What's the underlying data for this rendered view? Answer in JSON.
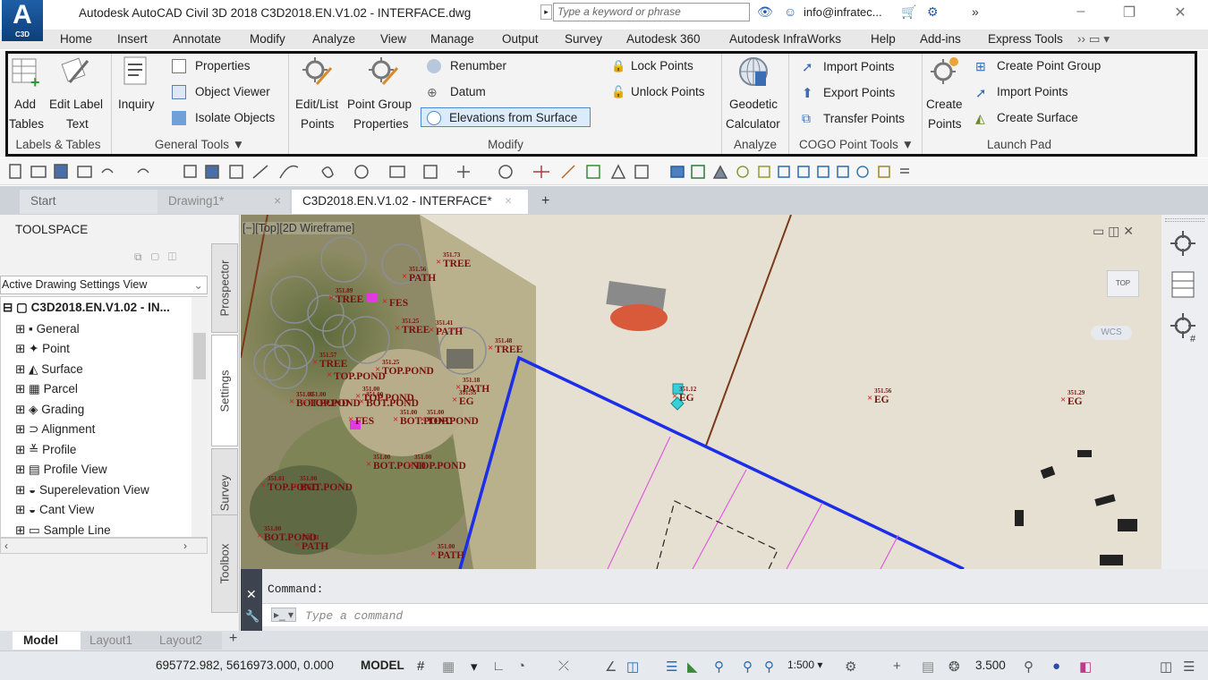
{
  "title_bar": {
    "app_logo": "A",
    "app_logo_sub": "C3D",
    "title": "Autodesk AutoCAD Civil 3D 2018    C3D2018.EN.V1.02 - INTERFACE.dwg",
    "search_placeholder": "Type a keyword or phrase",
    "user": "info@infratec...",
    "icons": [
      "binoculars-icon",
      "user-icon",
      "cart-icon",
      "autodesk-a360-icon",
      "expand-icon",
      "minimize-icon",
      "restore-icon",
      "close-icon"
    ]
  },
  "menu": {
    "items": [
      "Home",
      "Insert",
      "Annotate",
      "Modify",
      "Analyze",
      "View",
      "Manage",
      "Output",
      "Survey",
      "Autodesk 360",
      "Autodesk InfraWorks",
      "Help",
      "Add-ins",
      "Express Tools"
    ]
  },
  "ribbon": {
    "labels_tables": {
      "title": "Labels & Tables",
      "add_tables_1": "Add",
      "add_tables_2": "Tables",
      "edit_label_1": "Edit Label",
      "edit_label_2": "Text"
    },
    "general_tools": {
      "title": "General Tools ▼",
      "inquiry": "Inquiry",
      "properties": "Properties",
      "object_viewer": "Object Viewer",
      "isolate_objects": "Isolate Objects"
    },
    "modify": {
      "title": "Modify",
      "edit_list_1": "Edit/List",
      "edit_list_2": "Points",
      "pg_props_1": "Point Group",
      "pg_props_2": "Properties",
      "renumber": "Renumber",
      "datum": "Datum",
      "elevations": "Elevations from Surface",
      "lock_points": "Lock Points",
      "unlock_points": "Unlock Points"
    },
    "analyze": {
      "title": "Analyze",
      "geodetic_1": "Geodetic",
      "geodetic_2": "Calculator"
    },
    "cogo": {
      "title": "COGO Point Tools ▼",
      "import_points": "Import Points",
      "export_points": "Export Points",
      "transfer_points": "Transfer Points"
    },
    "launch_pad": {
      "title": "Launch Pad",
      "create_points_1": "Create",
      "create_points_2": "Points",
      "create_point_group": "Create Point Group",
      "import_points": "Import Points",
      "create_surface": "Create Surface"
    }
  },
  "doc_tabs": {
    "start": "Start",
    "drawing1": "Drawing1*",
    "active": "C3D2018.EN.V1.02 - INTERFACE*",
    "close": "×",
    "add": "+"
  },
  "toolspace": {
    "title": "TOOLSPACE",
    "view_select": "Active Drawing Settings View",
    "root": "C3D2018.EN.V1.02 - IN...",
    "items": [
      "General",
      "Point",
      "Surface",
      "Parcel",
      "Grading",
      "Alignment",
      "Profile",
      "Profile View",
      "Superelevation View",
      "Cant View",
      "Sample Line"
    ],
    "side_tabs": [
      "Prospector",
      "Settings",
      "Survey",
      "Toolbox"
    ]
  },
  "viewport": {
    "label": "[−][Top][2D Wireframe]",
    "wcs": "WCS",
    "cube_top": "TOP",
    "point_labels": [
      {
        "num": "351.73",
        "desc": "TREE"
      },
      {
        "num": "351.56",
        "desc": "PATH"
      },
      {
        "num": "351.89",
        "desc": "TREE"
      },
      {
        "num": "",
        "desc": "FES"
      },
      {
        "num": "351.25",
        "desc": "TREE"
      },
      {
        "num": "351.41",
        "desc": "PATH"
      },
      {
        "num": "351.48",
        "desc": "TREE"
      },
      {
        "num": "351.57",
        "desc": "TREE"
      },
      {
        "num": "",
        "desc": "TOP.POND"
      },
      {
        "num": "351.25",
        "desc": "TOP.POND"
      },
      {
        "num": "351.18",
        "desc": "PATH"
      },
      {
        "num": "351.00",
        "desc": "TOP.POND"
      },
      {
        "num": "351.00",
        "desc": "BOT.POND"
      },
      {
        "num": "351.55",
        "desc": "EG"
      },
      {
        "num": "351.12",
        "desc": "EG"
      },
      {
        "num": "351.56",
        "desc": "EG"
      },
      {
        "num": "351.29",
        "desc": "EG"
      },
      {
        "num": "351.00",
        "desc": "TOP.POND"
      },
      {
        "num": "351.00",
        "desc": "BOT.POND"
      },
      {
        "num": "",
        "desc": "FES"
      },
      {
        "num": "351.00",
        "desc": "BOT.POND"
      },
      {
        "num": "351.00",
        "desc": "TOP.POND"
      },
      {
        "num": "351.01",
        "desc": "TOP.POND"
      },
      {
        "num": "351.00",
        "desc": "BOT.POND"
      },
      {
        "num": "351.00",
        "desc": "BOT.POND"
      },
      {
        "num": "351.00",
        "desc": "TOP.POND"
      },
      {
        "num": "351.00",
        "desc": "BOT.POND"
      },
      {
        "num": "351.13",
        "desc": "PATH"
      },
      {
        "num": "351.00",
        "desc": "PATH"
      }
    ]
  },
  "command": {
    "label": "Command:",
    "placeholder": "Type a command"
  },
  "layout_tabs": {
    "model": "Model",
    "layout1": "Layout1",
    "layout2": "Layout2",
    "add": "+"
  },
  "status": {
    "coords": "695772.982, 5616973.000, 0.000",
    "model": "MODEL",
    "scale": "1:500 ▾",
    "elev": "3.500"
  }
}
